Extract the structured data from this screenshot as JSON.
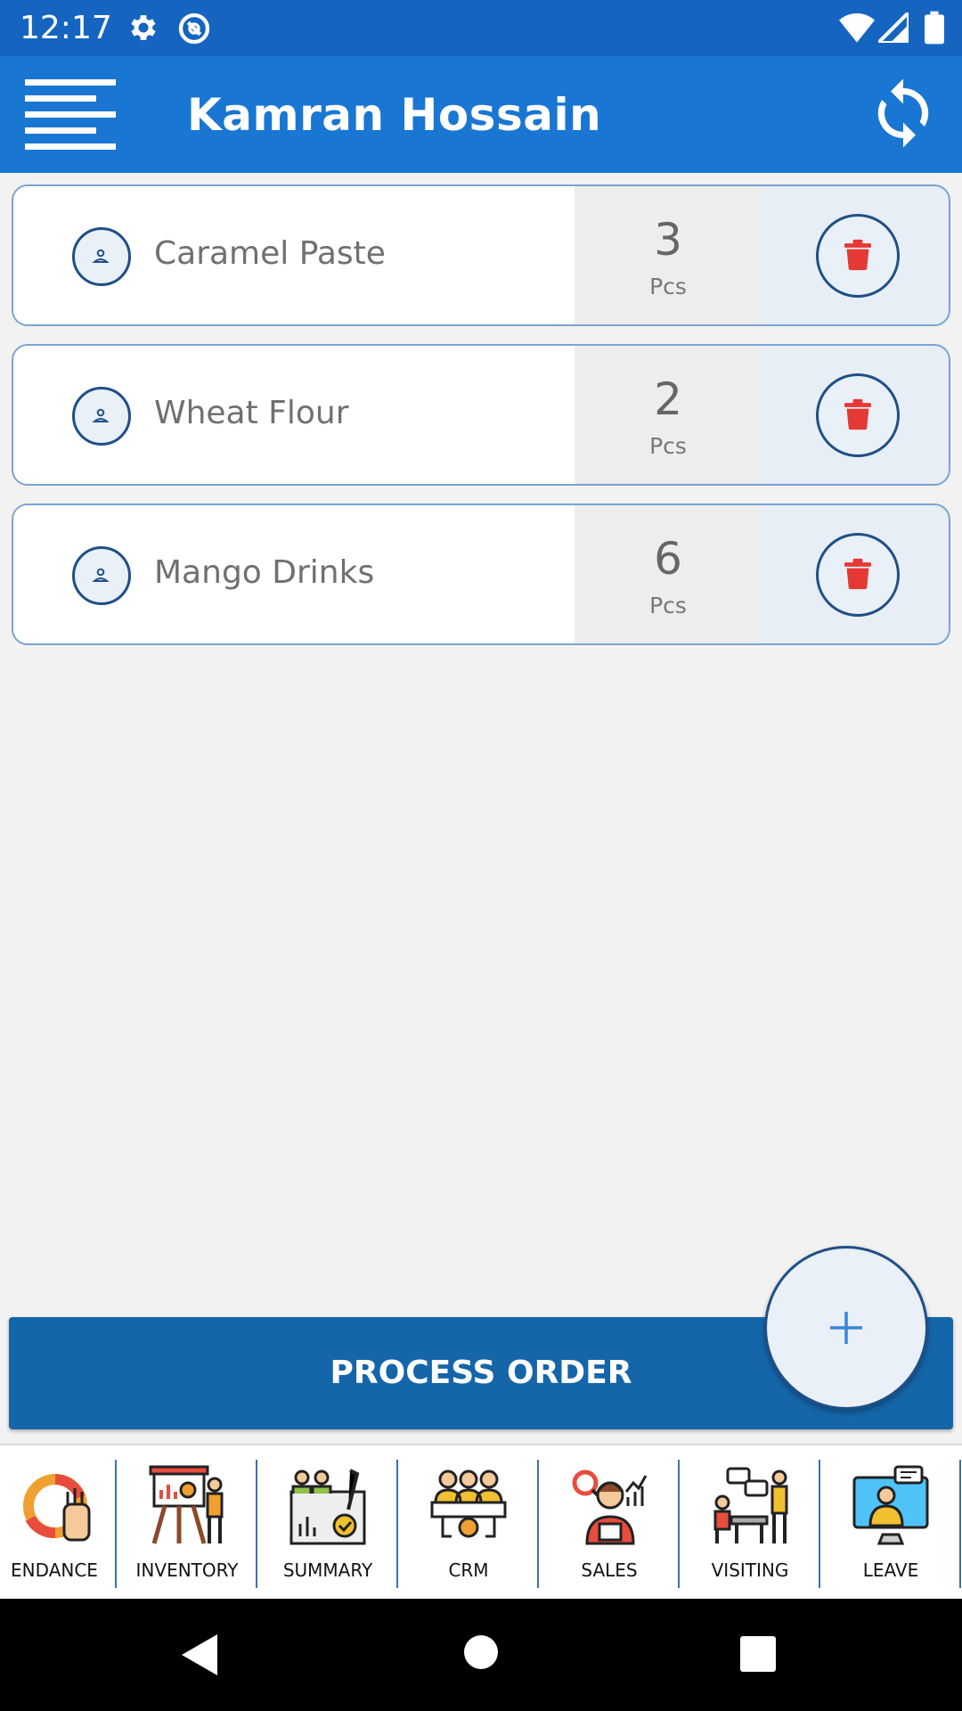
{
  "status_bar": {
    "time": "12:17"
  },
  "app_bar": {
    "title": "Kamran Hossain"
  },
  "items": [
    {
      "name": "Caramel Paste",
      "qty": "3",
      "unit": "Pcs"
    },
    {
      "name": "Wheat Flour",
      "qty": "2",
      "unit": "Pcs"
    },
    {
      "name": "Mango Drinks",
      "qty": "6",
      "unit": "Pcs"
    }
  ],
  "process_button": "PROCESS ORDER",
  "bottom_nav": [
    {
      "label": "ENDANCE",
      "icon": "attendance-icon"
    },
    {
      "label": "INVENTORY",
      "icon": "inventory-icon"
    },
    {
      "label": "SUMMARY",
      "icon": "summary-icon"
    },
    {
      "label": "CRM",
      "icon": "crm-icon"
    },
    {
      "label": "SALES",
      "icon": "sales-icon"
    },
    {
      "label": "VISITING",
      "icon": "visiting-icon"
    },
    {
      "label": "LEAVE",
      "icon": "leave-icon"
    }
  ],
  "colors": {
    "status_bar": "#1565c0",
    "app_bar": "#1976d2",
    "process_button": "#1565a9",
    "delete_icon": "#e53935",
    "outline": "#1f4f86"
  }
}
